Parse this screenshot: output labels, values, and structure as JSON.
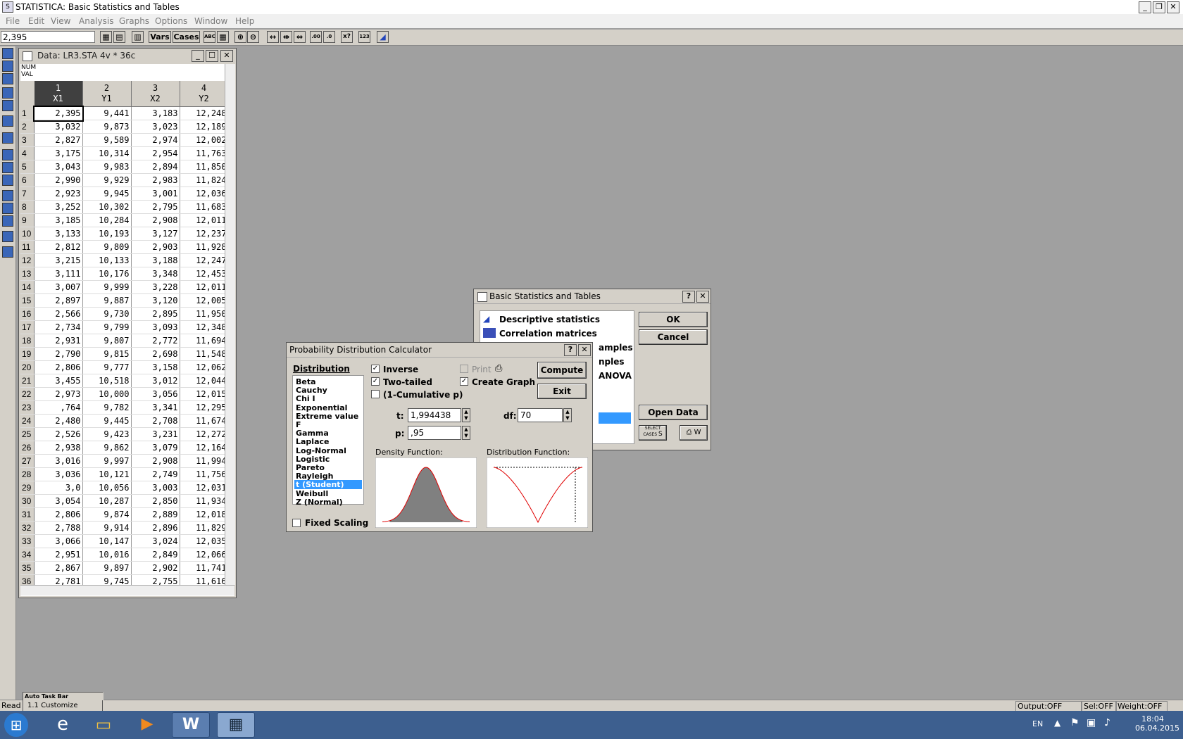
{
  "app": {
    "title": "STATISTICA: Basic Statistics and Tables"
  },
  "menu": [
    "File",
    "Edit",
    "View",
    "Analysis",
    "Graphs",
    "Options",
    "Window",
    "Help"
  ],
  "toolbar": {
    "cell_value": "2,395",
    "vars_label": "Vars",
    "cases_label": "Cases"
  },
  "data_window": {
    "title": "Data: LR3.STA 4v * 36c",
    "header_left": [
      "NUM",
      "VAL"
    ],
    "columns": [
      {
        "num": "1",
        "name": "X1"
      },
      {
        "num": "2",
        "name": "Y1"
      },
      {
        "num": "3",
        "name": "X2"
      },
      {
        "num": "4",
        "name": "Y2"
      }
    ],
    "rows": [
      [
        "1",
        "2,395",
        "9,441",
        "3,183",
        "12,248"
      ],
      [
        "2",
        "3,032",
        "9,873",
        "3,023",
        "12,189"
      ],
      [
        "3",
        "2,827",
        "9,589",
        "2,974",
        "12,002"
      ],
      [
        "4",
        "3,175",
        "10,314",
        "2,954",
        "11,763"
      ],
      [
        "5",
        "3,043",
        "9,983",
        "2,894",
        "11,850"
      ],
      [
        "6",
        "2,990",
        "9,929",
        "2,983",
        "11,824"
      ],
      [
        "7",
        "2,923",
        "9,945",
        "3,001",
        "12,036"
      ],
      [
        "8",
        "3,252",
        "10,302",
        "2,795",
        "11,683"
      ],
      [
        "9",
        "3,185",
        "10,284",
        "2,908",
        "12,011"
      ],
      [
        "10",
        "3,133",
        "10,193",
        "3,127",
        "12,237"
      ],
      [
        "11",
        "2,812",
        "9,809",
        "2,903",
        "11,928"
      ],
      [
        "12",
        "3,215",
        "10,133",
        "3,188",
        "12,247"
      ],
      [
        "13",
        "3,111",
        "10,176",
        "3,348",
        "12,453"
      ],
      [
        "14",
        "3,007",
        "9,999",
        "3,228",
        "12,011"
      ],
      [
        "15",
        "2,897",
        "9,887",
        "3,120",
        "12,005"
      ],
      [
        "16",
        "2,566",
        "9,730",
        "2,895",
        "11,950"
      ],
      [
        "17",
        "2,734",
        "9,799",
        "3,093",
        "12,348"
      ],
      [
        "18",
        "2,931",
        "9,807",
        "2,772",
        "11,694"
      ],
      [
        "19",
        "2,790",
        "9,815",
        "2,698",
        "11,548"
      ],
      [
        "20",
        "2,806",
        "9,777",
        "3,158",
        "12,062"
      ],
      [
        "21",
        "3,455",
        "10,518",
        "3,012",
        "12,044"
      ],
      [
        "22",
        "2,973",
        "10,000",
        "3,056",
        "12,015"
      ],
      [
        "23",
        ",764",
        "9,782",
        "3,341",
        "12,295"
      ],
      [
        "24",
        "2,480",
        "9,445",
        "2,708",
        "11,674"
      ],
      [
        "25",
        "2,526",
        "9,423",
        "3,231",
        "12,272"
      ],
      [
        "26",
        "2,938",
        "9,862",
        "3,079",
        "12,164"
      ],
      [
        "27",
        "3,016",
        "9,997",
        "2,908",
        "11,994"
      ],
      [
        "28",
        "3,036",
        "10,121",
        "2,749",
        "11,756"
      ],
      [
        "29",
        "3,0",
        "10,056",
        "3,003",
        "12,031"
      ],
      [
        "30",
        "3,054",
        "10,287",
        "2,850",
        "11,934"
      ],
      [
        "31",
        "2,806",
        "9,874",
        "2,889",
        "12,018"
      ],
      [
        "32",
        "2,788",
        "9,914",
        "2,896",
        "11,829"
      ],
      [
        "33",
        "3,066",
        "10,147",
        "3,024",
        "12,035"
      ],
      [
        "34",
        "2,951",
        "10,016",
        "2,849",
        "12,066"
      ],
      [
        "35",
        "2,867",
        "9,897",
        "2,902",
        "11,741"
      ],
      [
        "36",
        "2,781",
        "9,745",
        "2,755",
        "11,616"
      ]
    ]
  },
  "basic_stats_dialog": {
    "title": "Basic Statistics and Tables",
    "items": [
      "Descriptive statistics",
      "Correlation matrices"
    ],
    "partial_items": [
      "amples",
      "nples",
      "ANOVA"
    ],
    "ok_label": "OK",
    "cancel_label": "Cancel",
    "open_data_label": "Open Data",
    "select_cases_label": "SELECT CASES",
    "s_label": "S",
    "w_label": "W"
  },
  "prob_dialog": {
    "title": "Probability Distribution Calculator",
    "distribution_label": "Distribution",
    "distributions": [
      "Beta",
      "Cauchy",
      "Chi I",
      "Exponential",
      "Extreme value",
      "F",
      "Gamma",
      "Laplace",
      "Log-Normal",
      "Logistic",
      "Pareto",
      "Rayleigh",
      "t (Student)",
      "Weibull",
      "Z (Normal)"
    ],
    "selected_distribution": "t (Student)",
    "inverse_label": "Inverse",
    "two_tailed_label": "Two-tailed",
    "cumulative_label": "(1-Cumulative p)",
    "print_label": "Print",
    "create_graph_label": "Create Graph",
    "compute_label": "Compute",
    "exit_label": "Exit",
    "t_label": "t:",
    "t_value": "1,994438",
    "p_label": "p:",
    "p_value": ",95",
    "df_label": "df:",
    "df_value": "70",
    "density_label": "Density Function:",
    "distribution_fn_label": "Distribution Function:",
    "fixed_scaling_label": "Fixed Scaling",
    "curve_color": "#e00000",
    "fill_color": "#808080"
  },
  "bottom": {
    "ready": "Read",
    "customize_title": "Auto Task Bar",
    "customize_item": "1.1 Customize",
    "output": "Output:OFF",
    "sel": "Sel:OFF",
    "weight": "Weight:OFF"
  },
  "tray": {
    "lang": "EN",
    "time": "18:04",
    "date": "06.04.2015"
  }
}
